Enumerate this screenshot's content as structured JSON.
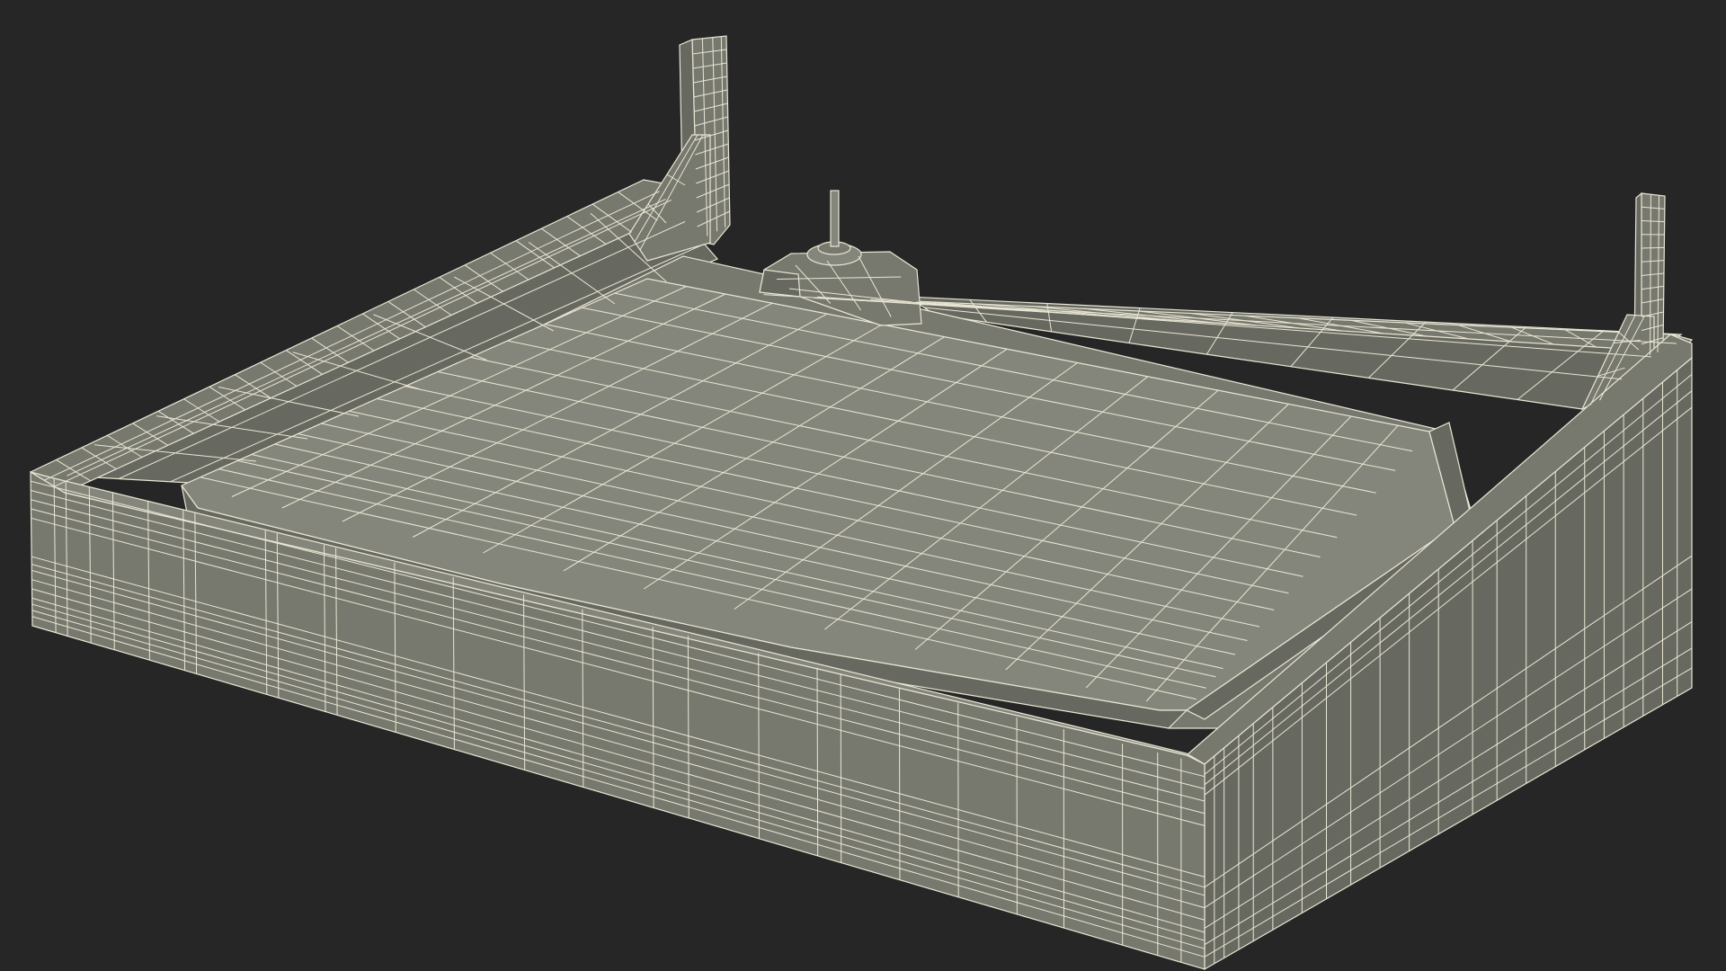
{
  "scene": {
    "subject": "wireframe-tray-model",
    "colors": {
      "background": "#262626",
      "surface": "#77786e",
      "surface_dark": "#67685f",
      "surface_light": "#85867b",
      "wire": "#e9e6d4"
    }
  }
}
